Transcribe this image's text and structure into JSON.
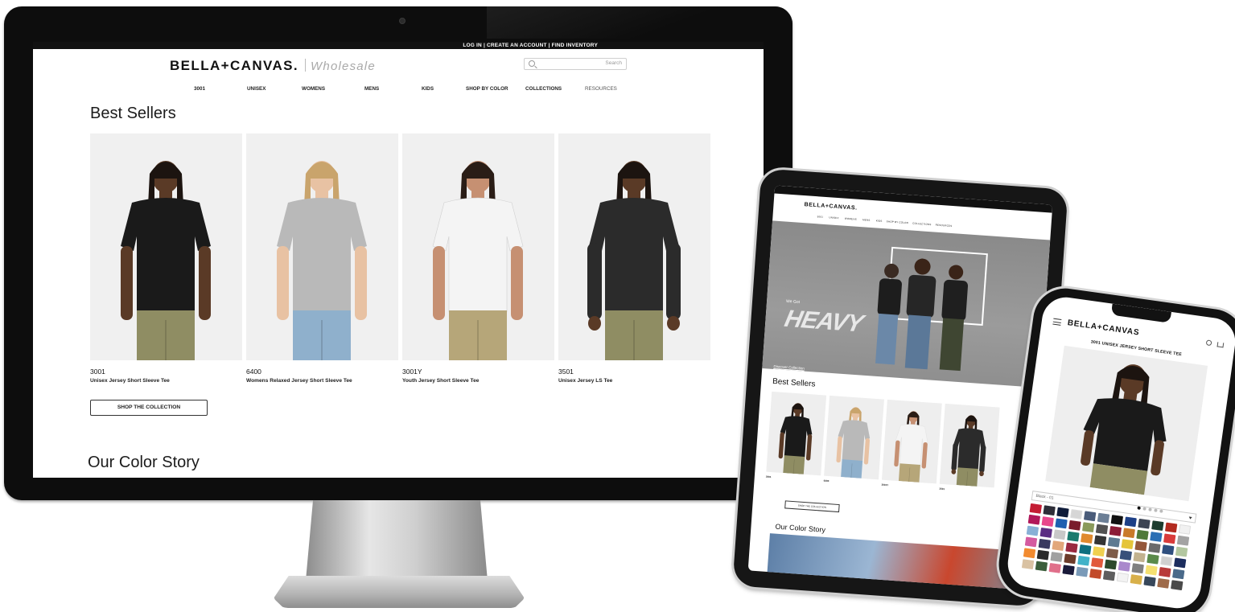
{
  "desktop": {
    "top_links": "LOG IN | CREATE AN ACCOUNT | FIND INVENTORY",
    "logo_main": "BELLA+CANVAS.",
    "logo_sub": "Wholesale",
    "search_placeholder": "Search",
    "nav": [
      "3001",
      "UNISEX",
      "WOMENS",
      "MENS",
      "KIDS",
      "SHOP BY COLOR",
      "COLLECTIONS",
      "RESOURCES"
    ],
    "section_title": "Best Sellers",
    "products": [
      {
        "code": "3001",
        "name": "Unisex Jersey Short Sleeve Tee",
        "shirt": "#1a1a1a",
        "sleeve": "short",
        "pants": "#8f8d63",
        "skin": "#5a3a26",
        "hair": "#1c1410"
      },
      {
        "code": "6400",
        "name": "Womens Relaxed Jersey Short Sleeve Tee",
        "shirt": "#b9b9b9",
        "sleeve": "short",
        "pants": "#8fb0cc",
        "skin": "#e8c2a3",
        "hair": "#c9a46c"
      },
      {
        "code": "3001Y",
        "name": "Youth Jersey Short Sleeve Tee",
        "shirt": "#f4f4f4",
        "sleeve": "short",
        "pants": "#b6a679",
        "skin": "#c69072",
        "hair": "#2a1d16"
      },
      {
        "code": "3501",
        "name": "Unisex Jersey LS Tee",
        "shirt": "#2b2b2b",
        "sleeve": "long",
        "pants": "#8f8d63",
        "skin": "#5a3a26",
        "hair": "#1c1410"
      }
    ],
    "shop_button": "SHOP THE COLLECTION",
    "color_title": "Our Color Story"
  },
  "tablet": {
    "logo": "BELLA+CANVAS.",
    "hero_small": "We Got",
    "hero_big": "HEAVY",
    "discover": "Discover Collection",
    "section_title": "Best Sellers",
    "shop_button": "SHOP THE COLLECTION",
    "color_title": "Our Color Story"
  },
  "phone": {
    "logo": "BELLA+CANVAS",
    "product_title": "3001 UNISEX JERSEY SHORT SLEEVE TEE",
    "selected_color": "Black - 01",
    "swatches": [
      "#c41d34",
      "#2e2e38",
      "#0f1c3a",
      "#d6d6d6",
      "#4a5c7a",
      "#6c7f96",
      "#111111",
      "#1d3f86",
      "#3d4454",
      "#1c3d2f",
      "#b22b20",
      "#f1f1f1",
      "#b1185a",
      "#e8478c",
      "#1f60b0",
      "#7a1c2c",
      "#8a9a5b",
      "#525252",
      "#8c1c36",
      "#c97a2a",
      "#4f7a3a",
      "#2a6fb4",
      "#d93b3b",
      "#a3a3a3",
      "#88b0d6",
      "#5b2d82",
      "#c8c8c8",
      "#1a7a6e",
      "#e08a2e",
      "#343434",
      "#5d7a91",
      "#e5c53a",
      "#94573a",
      "#6b6b6b",
      "#2f4f7f",
      "#b3c7a0",
      "#d45aa0",
      "#3a3a60",
      "#e2a77b",
      "#9a2a40",
      "#0d6f7f",
      "#f0d050",
      "#7e5c49",
      "#38507a",
      "#c2b28f",
      "#5a8a4a",
      "#d0d0d0",
      "#1c2d5e",
      "#f28b30",
      "#2a2a2a",
      "#a0a0a0",
      "#6c3b2a",
      "#42b2c8",
      "#e15a3c",
      "#2c4a2c",
      "#aa88cc",
      "#808080",
      "#f5e070",
      "#b83a3a",
      "#4a6a8a",
      "#d9c2a3",
      "#3b5e3b",
      "#e06f8a",
      "#1a1a3a",
      "#7a9ab8",
      "#c24a2a",
      "#5e5e5e",
      "#f3f3f3",
      "#d8b04a",
      "#37475a",
      "#9f6b4a",
      "#4a4a4a"
    ]
  }
}
